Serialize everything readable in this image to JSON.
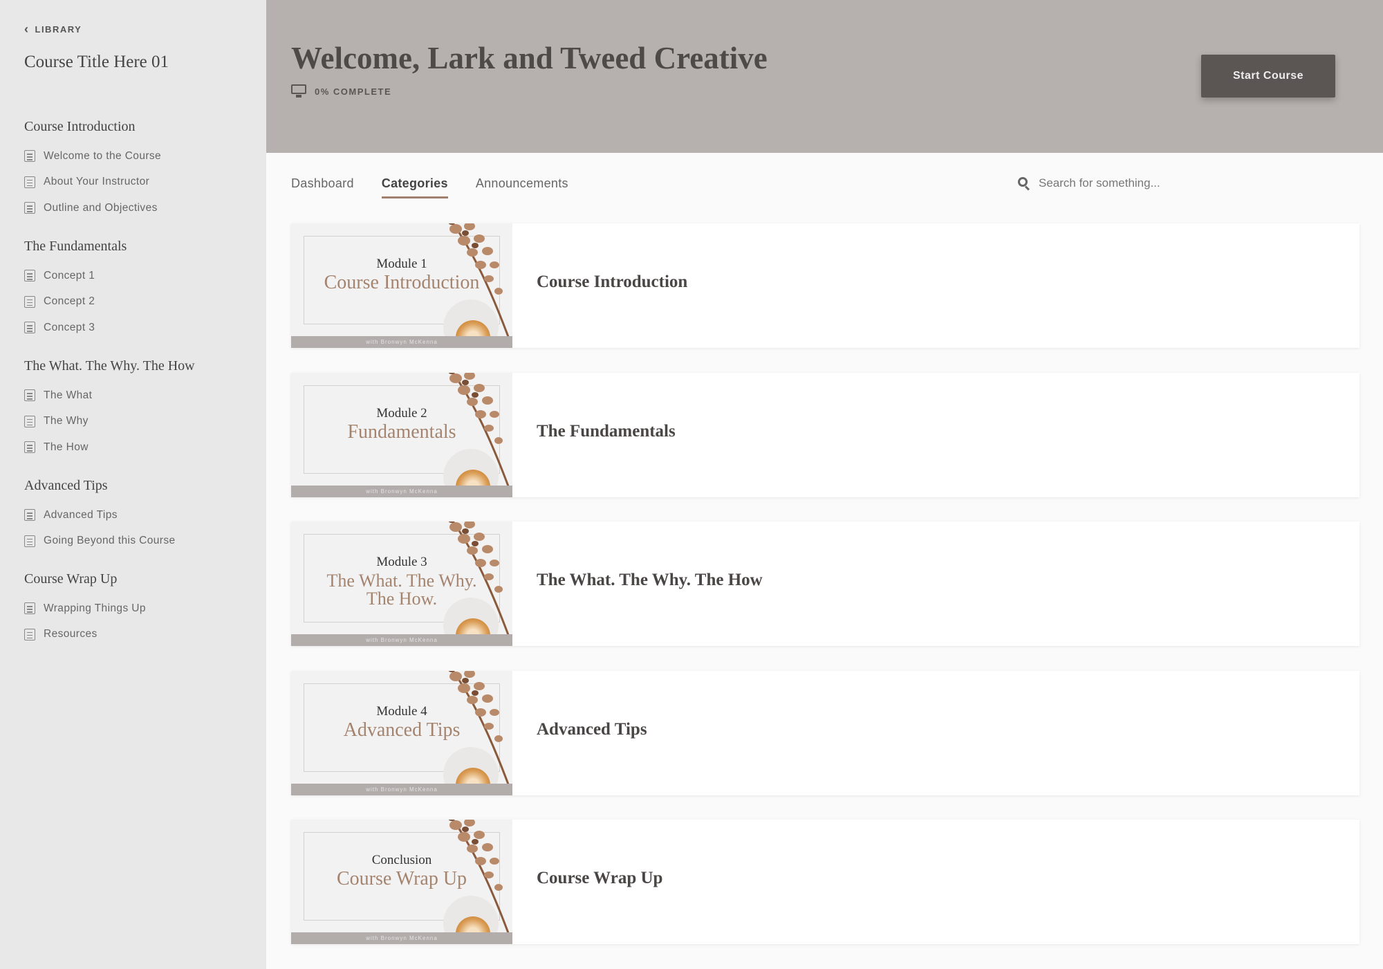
{
  "sidebar": {
    "back_label": "LIBRARY",
    "course_title": "Course Title Here 01",
    "sections": [
      {
        "title": "Course Introduction",
        "lessons": [
          "Welcome to the Course",
          "About Your Instructor",
          "Outline and Objectives"
        ]
      },
      {
        "title": "The Fundamentals",
        "lessons": [
          "Concept 1",
          "Concept 2",
          "Concept 3"
        ]
      },
      {
        "title": "The What. The Why. The How",
        "lessons": [
          "The What",
          "The Why",
          "The How"
        ]
      },
      {
        "title": "Advanced Tips",
        "lessons": [
          "Advanced Tips",
          "Going Beyond this Course"
        ]
      },
      {
        "title": "Course Wrap Up",
        "lessons": [
          "Wrapping Things Up",
          "Resources"
        ]
      }
    ]
  },
  "header": {
    "welcome": "Welcome, Lark and Tweed Creative",
    "progress": "0% COMPLETE",
    "start_button": "Start Course"
  },
  "tabs": [
    {
      "label": "Dashboard",
      "active": false
    },
    {
      "label": "Categories",
      "active": true
    },
    {
      "label": "Announcements",
      "active": false
    }
  ],
  "search": {
    "placeholder": "Search for something..."
  },
  "categories": [
    {
      "module": "Module 1",
      "thumb_title": "Course Introduction",
      "title": "Course Introduction",
      "byline": "with Bronwyn McKenna"
    },
    {
      "module": "Module 2",
      "thumb_title": "Fundamentals",
      "title": "The Fundamentals",
      "byline": "with Bronwyn McKenna"
    },
    {
      "module": "Module 3",
      "thumb_title": "The What. The Why. The How.",
      "title": "The What. The Why. The How",
      "byline": "with Bronwyn McKenna"
    },
    {
      "module": "Module 4",
      "thumb_title": "Advanced Tips",
      "title": "Advanced Tips",
      "byline": "with Bronwyn McKenna"
    },
    {
      "module": "Conclusion",
      "thumb_title": "Course Wrap Up",
      "title": "Course Wrap Up",
      "byline": "with Bronwyn McKenna"
    }
  ],
  "colors": {
    "header_bg": "#b6b1ae",
    "sidebar_bg": "#e8e8e8",
    "accent": "#a07f6e",
    "button_bg": "#5b5553"
  },
  "icons": {
    "back": "chevron-left-icon",
    "lesson": "document-icon",
    "progress": "monitor-icon",
    "search": "search-icon"
  }
}
